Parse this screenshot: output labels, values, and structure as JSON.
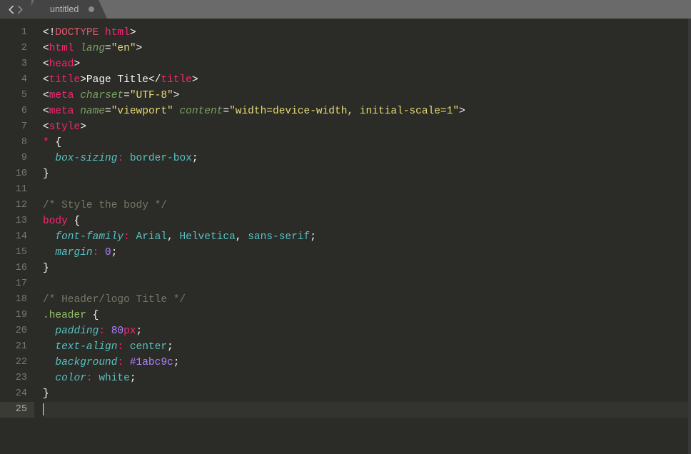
{
  "tab": {
    "title": "untitled"
  },
  "active_line": 25,
  "lines": [
    {
      "n": 1,
      "t": [
        [
          "<!",
          "w"
        ],
        [
          "DOCTYPE",
          "red"
        ],
        [
          " ",
          "w"
        ],
        [
          "html",
          "pink"
        ],
        [
          ">",
          "w"
        ]
      ]
    },
    {
      "n": 2,
      "t": [
        [
          "<",
          "w"
        ],
        [
          "html",
          "pink"
        ],
        [
          " ",
          "w"
        ],
        [
          "lang",
          "attr"
        ],
        [
          "=",
          "w"
        ],
        [
          "\"en\"",
          "yellow"
        ],
        [
          ">",
          "w"
        ]
      ]
    },
    {
      "n": 3,
      "t": [
        [
          "<",
          "w"
        ],
        [
          "head",
          "pink"
        ],
        [
          ">",
          "w"
        ]
      ]
    },
    {
      "n": 4,
      "t": [
        [
          "<",
          "w"
        ],
        [
          "title",
          "pink"
        ],
        [
          ">",
          "w"
        ],
        [
          "Page Title",
          "w"
        ],
        [
          "</",
          "w"
        ],
        [
          "title",
          "pink"
        ],
        [
          ">",
          "w"
        ]
      ]
    },
    {
      "n": 5,
      "t": [
        [
          "<",
          "w"
        ],
        [
          "meta",
          "pink"
        ],
        [
          " ",
          "w"
        ],
        [
          "charset",
          "attr"
        ],
        [
          "=",
          "w"
        ],
        [
          "\"UTF-8\"",
          "yellow"
        ],
        [
          ">",
          "w"
        ]
      ]
    },
    {
      "n": 6,
      "t": [
        [
          "<",
          "w"
        ],
        [
          "meta",
          "pink"
        ],
        [
          " ",
          "w"
        ],
        [
          "name",
          "attr"
        ],
        [
          "=",
          "w"
        ],
        [
          "\"viewport\"",
          "yellow"
        ],
        [
          " ",
          "w"
        ],
        [
          "content",
          "attr"
        ],
        [
          "=",
          "w"
        ],
        [
          "\"width=device-width, initial-scale=1\"",
          "yellow"
        ],
        [
          ">",
          "w"
        ]
      ]
    },
    {
      "n": 7,
      "t": [
        [
          "<",
          "w"
        ],
        [
          "style",
          "pink"
        ],
        [
          ">",
          "w"
        ]
      ]
    },
    {
      "n": 8,
      "t": [
        [
          "*",
          "pink"
        ],
        [
          " {",
          "w"
        ]
      ]
    },
    {
      "n": 9,
      "t": [
        [
          "  ",
          "w"
        ],
        [
          "box-sizing",
          "cyan"
        ],
        [
          ":",
          "pink"
        ],
        [
          " ",
          "w"
        ],
        [
          "border-box",
          "cyanp"
        ],
        [
          ";",
          "w"
        ]
      ]
    },
    {
      "n": 10,
      "t": [
        [
          "}",
          "w"
        ]
      ]
    },
    {
      "n": 11,
      "t": [
        [
          "",
          "w"
        ]
      ]
    },
    {
      "n": 12,
      "t": [
        [
          "/* Style the body */",
          "gray"
        ]
      ]
    },
    {
      "n": 13,
      "t": [
        [
          "body",
          "pink"
        ],
        [
          " {",
          "w"
        ]
      ]
    },
    {
      "n": 14,
      "t": [
        [
          "  ",
          "w"
        ],
        [
          "font-family",
          "cyan"
        ],
        [
          ":",
          "pink"
        ],
        [
          " ",
          "w"
        ],
        [
          "Arial",
          "cyanp"
        ],
        [
          ",",
          "w"
        ],
        [
          " ",
          "w"
        ],
        [
          "Helvetica",
          "cyanp"
        ],
        [
          ",",
          "w"
        ],
        [
          " ",
          "w"
        ],
        [
          "sans-serif",
          "cyanp"
        ],
        [
          ";",
          "w"
        ]
      ]
    },
    {
      "n": 15,
      "t": [
        [
          "  ",
          "w"
        ],
        [
          "margin",
          "cyan"
        ],
        [
          ":",
          "pink"
        ],
        [
          " ",
          "w"
        ],
        [
          "0",
          "purple"
        ],
        [
          ";",
          "w"
        ]
      ]
    },
    {
      "n": 16,
      "t": [
        [
          "}",
          "w"
        ]
      ]
    },
    {
      "n": 17,
      "t": [
        [
          "",
          "w"
        ]
      ]
    },
    {
      "n": 18,
      "t": [
        [
          "/* Header/logo Title */",
          "gray"
        ]
      ]
    },
    {
      "n": 19,
      "t": [
        [
          ".header",
          "green"
        ],
        [
          " {",
          "w"
        ]
      ]
    },
    {
      "n": 20,
      "t": [
        [
          "  ",
          "w"
        ],
        [
          "padding",
          "cyan"
        ],
        [
          ":",
          "pink"
        ],
        [
          " ",
          "w"
        ],
        [
          "80",
          "purple"
        ],
        [
          "px",
          "pink"
        ],
        [
          ";",
          "w"
        ]
      ]
    },
    {
      "n": 21,
      "t": [
        [
          "  ",
          "w"
        ],
        [
          "text-align",
          "cyan"
        ],
        [
          ":",
          "pink"
        ],
        [
          " ",
          "w"
        ],
        [
          "center",
          "cyanp"
        ],
        [
          ";",
          "w"
        ]
      ]
    },
    {
      "n": 22,
      "t": [
        [
          "  ",
          "w"
        ],
        [
          "background",
          "cyan"
        ],
        [
          ":",
          "pink"
        ],
        [
          " ",
          "w"
        ],
        [
          "#",
          "purple"
        ],
        [
          "1abc9c",
          "purple"
        ],
        [
          ";",
          "w"
        ]
      ]
    },
    {
      "n": 23,
      "t": [
        [
          "  ",
          "w"
        ],
        [
          "color",
          "cyan"
        ],
        [
          ":",
          "pink"
        ],
        [
          " ",
          "w"
        ],
        [
          "white",
          "cyanp"
        ],
        [
          ";",
          "w"
        ]
      ]
    },
    {
      "n": 24,
      "t": [
        [
          "}",
          "w"
        ]
      ]
    },
    {
      "n": 25,
      "t": [
        [
          "",
          "w"
        ]
      ]
    }
  ]
}
